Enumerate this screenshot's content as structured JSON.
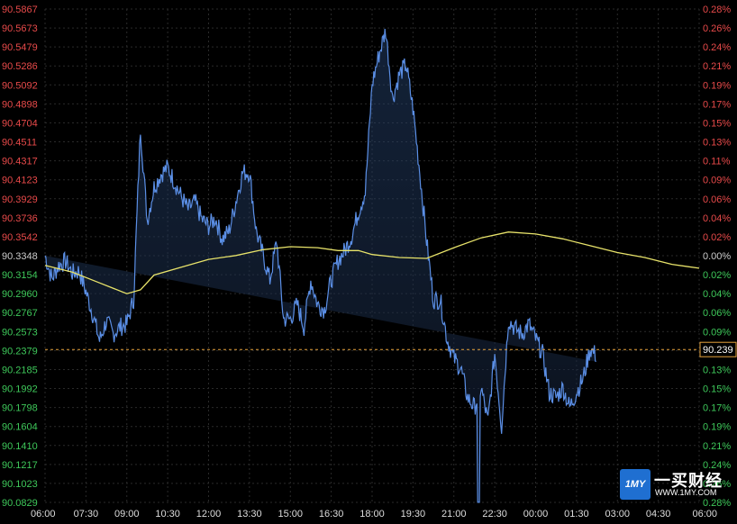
{
  "chart_data": {
    "type": "line",
    "left_axis_ticks": [
      "90.5867",
      "90.5673",
      "90.5479",
      "90.5286",
      "90.5092",
      "90.4898",
      "90.4704",
      "90.4511",
      "90.4317",
      "90.4123",
      "90.3929",
      "90.3736",
      "90.3542",
      "90.3348",
      "90.3154",
      "90.2960",
      "90.2767",
      "90.2573",
      "90.2379",
      "90.2185",
      "90.1992",
      "90.1798",
      "90.1604",
      "90.1410",
      "90.1217",
      "90.1023",
      "90.0829"
    ],
    "right_axis_ticks": [
      "0.28%",
      "0.26%",
      "0.24%",
      "0.21%",
      "0.19%",
      "0.17%",
      "0.15%",
      "0.13%",
      "0.11%",
      "0.09%",
      "0.06%",
      "0.04%",
      "0.02%",
      "0.00%",
      "0.02%",
      "0.04%",
      "0.06%",
      "0.09%",
      "0.11%",
      "0.13%",
      "0.15%",
      "0.17%",
      "0.19%",
      "0.21%",
      "0.24%",
      "0.26%",
      "0.28%"
    ],
    "x_ticks": [
      "06:00",
      "07:30",
      "09:00",
      "10:30",
      "12:00",
      "13:30",
      "15:00",
      "16:30",
      "18:00",
      "19:30",
      "21:00",
      "22:30",
      "00:00",
      "01:30",
      "03:00",
      "04:30",
      "06:00"
    ],
    "ylim": [
      90.0829,
      90.5867
    ],
    "reference_value": 90.3348,
    "colors": {
      "price": "#5b8fe6",
      "average": "#e8e36a",
      "up": "#e84a4a",
      "down": "#3ec85a",
      "marker": "#e6a23c"
    },
    "price_series": {
      "x_hours": [
        0,
        0.25,
        0.5,
        0.75,
        1,
        1.25,
        1.5,
        1.75,
        2,
        2.25,
        2.5,
        2.75,
        3,
        3.25,
        3.5,
        3.75,
        4,
        4.25,
        4.5,
        4.75,
        5,
        5.25,
        5.5,
        5.75,
        6,
        6.25,
        6.5,
        6.75,
        7,
        7.25,
        7.5,
        7.75,
        8,
        8.25,
        8.5,
        8.75,
        9,
        9.25,
        9.5,
        9.75,
        10,
        10.25,
        10.5,
        10.75,
        11,
        11.25,
        11.5,
        11.75,
        12,
        12.25,
        12.5,
        12.75,
        13,
        13.25,
        13.5,
        13.75,
        14,
        14.25,
        14.5,
        14.75,
        15,
        15.25,
        15.5,
        15.75,
        16,
        16.25,
        16.5,
        16.75,
        17,
        17.25,
        17.5,
        17.75,
        18,
        18.25,
        18.5,
        18.75,
        19,
        19.25,
        19.5,
        19.75,
        20,
        20.25,
        20.5,
        20.75,
        21,
        21.25,
        21.5,
        21.75,
        22,
        22.25,
        22.5,
        22.75,
        23,
        23.25,
        23.5,
        23.75,
        24
      ],
      "values": [
        90.335,
        90.311,
        90.325,
        90.329,
        90.317,
        90.319,
        90.298,
        90.275,
        90.248,
        90.268,
        90.255,
        90.262,
        90.265,
        90.29,
        90.465,
        90.371,
        90.405,
        90.418,
        90.425,
        90.41,
        90.395,
        90.382,
        90.39,
        90.372,
        90.365,
        90.373,
        90.352,
        90.36,
        90.39,
        90.42,
        90.42,
        90.36,
        90.335,
        90.31,
        90.35,
        90.27,
        90.27,
        90.285,
        90.262,
        90.31,
        90.285,
        90.28,
        90.31,
        90.33,
        90.34,
        90.355,
        90.38,
        90.4,
        90.51,
        90.54,
        90.565,
        90.495,
        90.52,
        90.53,
        90.485,
        90.42,
        90.35,
        90.29,
        90.29,
        90.25,
        90.23,
        90.22,
        90.19,
        90.18,
        90.2,
        90.165,
        90.235,
        90.16,
        90.27,
        90.26,
        90.255,
        90.265,
        90.25,
        90.235,
        90.195,
        90.19,
        90.2,
        90.18,
        90.195,
        90.21,
        90.24,
        90.232
      ],
      "spike_low_hour": 15.9,
      "spike_low_value": 90.083
    },
    "average_series": {
      "x_hours": [
        0,
        1,
        2,
        3,
        3.5,
        4,
        5,
        6,
        7,
        8,
        9,
        10,
        10.75,
        11.5,
        12,
        13,
        14,
        15,
        16,
        17,
        18,
        19,
        20,
        21,
        22,
        23,
        24
      ],
      "values": [
        90.325,
        90.318,
        90.307,
        90.296,
        90.3,
        90.315,
        90.323,
        90.331,
        90.335,
        90.341,
        90.344,
        90.343,
        90.34,
        90.34,
        90.336,
        90.333,
        90.332,
        90.343,
        90.353,
        90.359,
        90.357,
        90.352,
        90.345,
        90.338,
        90.333,
        90.326,
        90.322
      ]
    },
    "last_value_label": "90.239"
  },
  "logo": {
    "badge": "1MY",
    "name": "一买财经",
    "url": "WWW.1MY.COM"
  }
}
